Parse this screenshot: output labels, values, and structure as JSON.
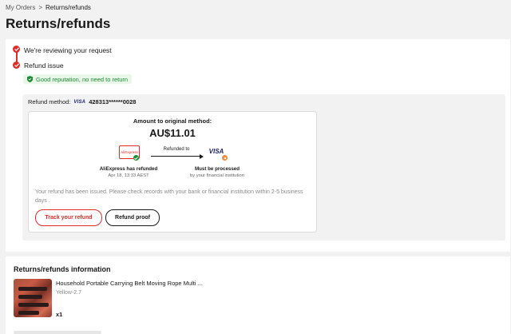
{
  "breadcrumb": {
    "parent": "My Orders",
    "separator": ">",
    "current": "Returns/refunds"
  },
  "page_title": "Returns/refunds",
  "steps": [
    {
      "label": "We're reviewing your request"
    },
    {
      "label": "Refund issue"
    }
  ],
  "reputation_badge": "Good reputation, no need to return",
  "refund_method": {
    "label": "Refund method:",
    "brand": "VISA",
    "card_number": "428313******0028"
  },
  "amount": {
    "title": "Amount to original method:",
    "value": "AU$11.01"
  },
  "flow": {
    "source_logo": "AliExpress",
    "arrow_label": "Refunded to",
    "dest_logo": "VISA",
    "source_status": "AliExpress has refunded",
    "source_time": "Apr 18, 13:33 AEST",
    "dest_status": "Must be processed",
    "dest_sub": "by your financial institution"
  },
  "note": "Your refund has been issued. Please check records with your bank or financial institution within 2-5 business days .",
  "buttons": {
    "track": "Track your refund",
    "proof": "Refund proof"
  },
  "info": {
    "title": "Returns/refunds information",
    "product_title": "Household Portable Carrying Belt Moving Rope Multi ...",
    "variant": "Yellow-2.7",
    "quantity": "x1"
  },
  "colors": {
    "accent_red": "#e02b27",
    "success_green": "#1f8a33",
    "pending_orange": "#f08a3c",
    "visa_blue": "#1a1f71"
  },
  "icons": [
    "check-icon",
    "shield-check-icon",
    "arrow-right-icon",
    "visa-logo",
    "aliexpress-logo"
  ]
}
